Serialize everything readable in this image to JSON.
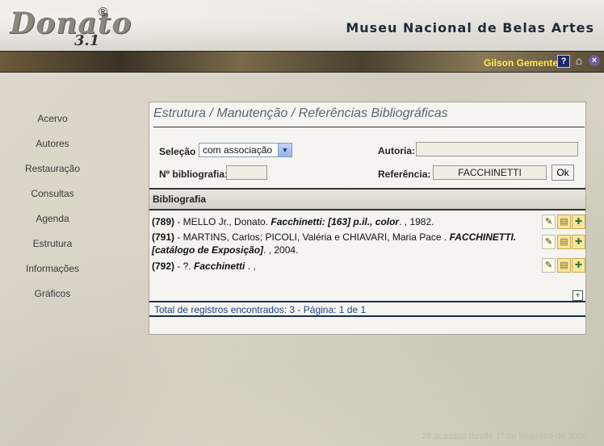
{
  "brand": {
    "logo_text": "Donato",
    "version": "3.1",
    "reg_mark": "®"
  },
  "header": {
    "museum_title": "Museu Nacional de Belas Artes",
    "user_name": "Gilson Gemente"
  },
  "nav": {
    "items": [
      "Acervo",
      "Autores",
      "Restauração",
      "Consultas",
      "Agenda",
      "Estrutura",
      "Informações",
      "Gráficos"
    ]
  },
  "panel": {
    "title": "Estrutura / Manutenção / Referências Bibliográficas",
    "filters": {
      "selecao_label": "Seleção",
      "selecao_value": "com associação",
      "autoria_label": "Autoria:",
      "autoria_value": "",
      "numero_label": "Nº bibliografia:",
      "numero_value": "",
      "referencia_label": "Referência:",
      "referencia_value": "FACCHINETTI",
      "ok_label": "Ok"
    },
    "section_title": "Bibliografia",
    "records": [
      {
        "id": "(789)",
        "pre": " - MELLO Jr., Donato. ",
        "title": "Facchinetti: [163] p.il., color",
        "post": ". , 1982."
      },
      {
        "id": "(791)",
        "pre": " - MARTINS, Carlos; PICOLI, Valéria e CHIAVARI, Maria Pace . ",
        "title": "FACCHINETTI. [catálogo de Exposição]",
        "post": ". , 2004."
      },
      {
        "id": "(792)",
        "pre": " - ?. ",
        "title": "Facchinetti",
        "post": " . ,"
      }
    ],
    "footer": "Total de registros encontrados: 3 - Página: 1 de 1"
  },
  "access_counter": "28 acessos desde 1º de fevereiro de 2008",
  "icons": {
    "help": "help-icon",
    "home": "home-icon",
    "close": "close-icon",
    "edit": "edit-icon",
    "view": "document-icon",
    "associate": "document-add-icon",
    "expand": "plus-icon"
  }
}
